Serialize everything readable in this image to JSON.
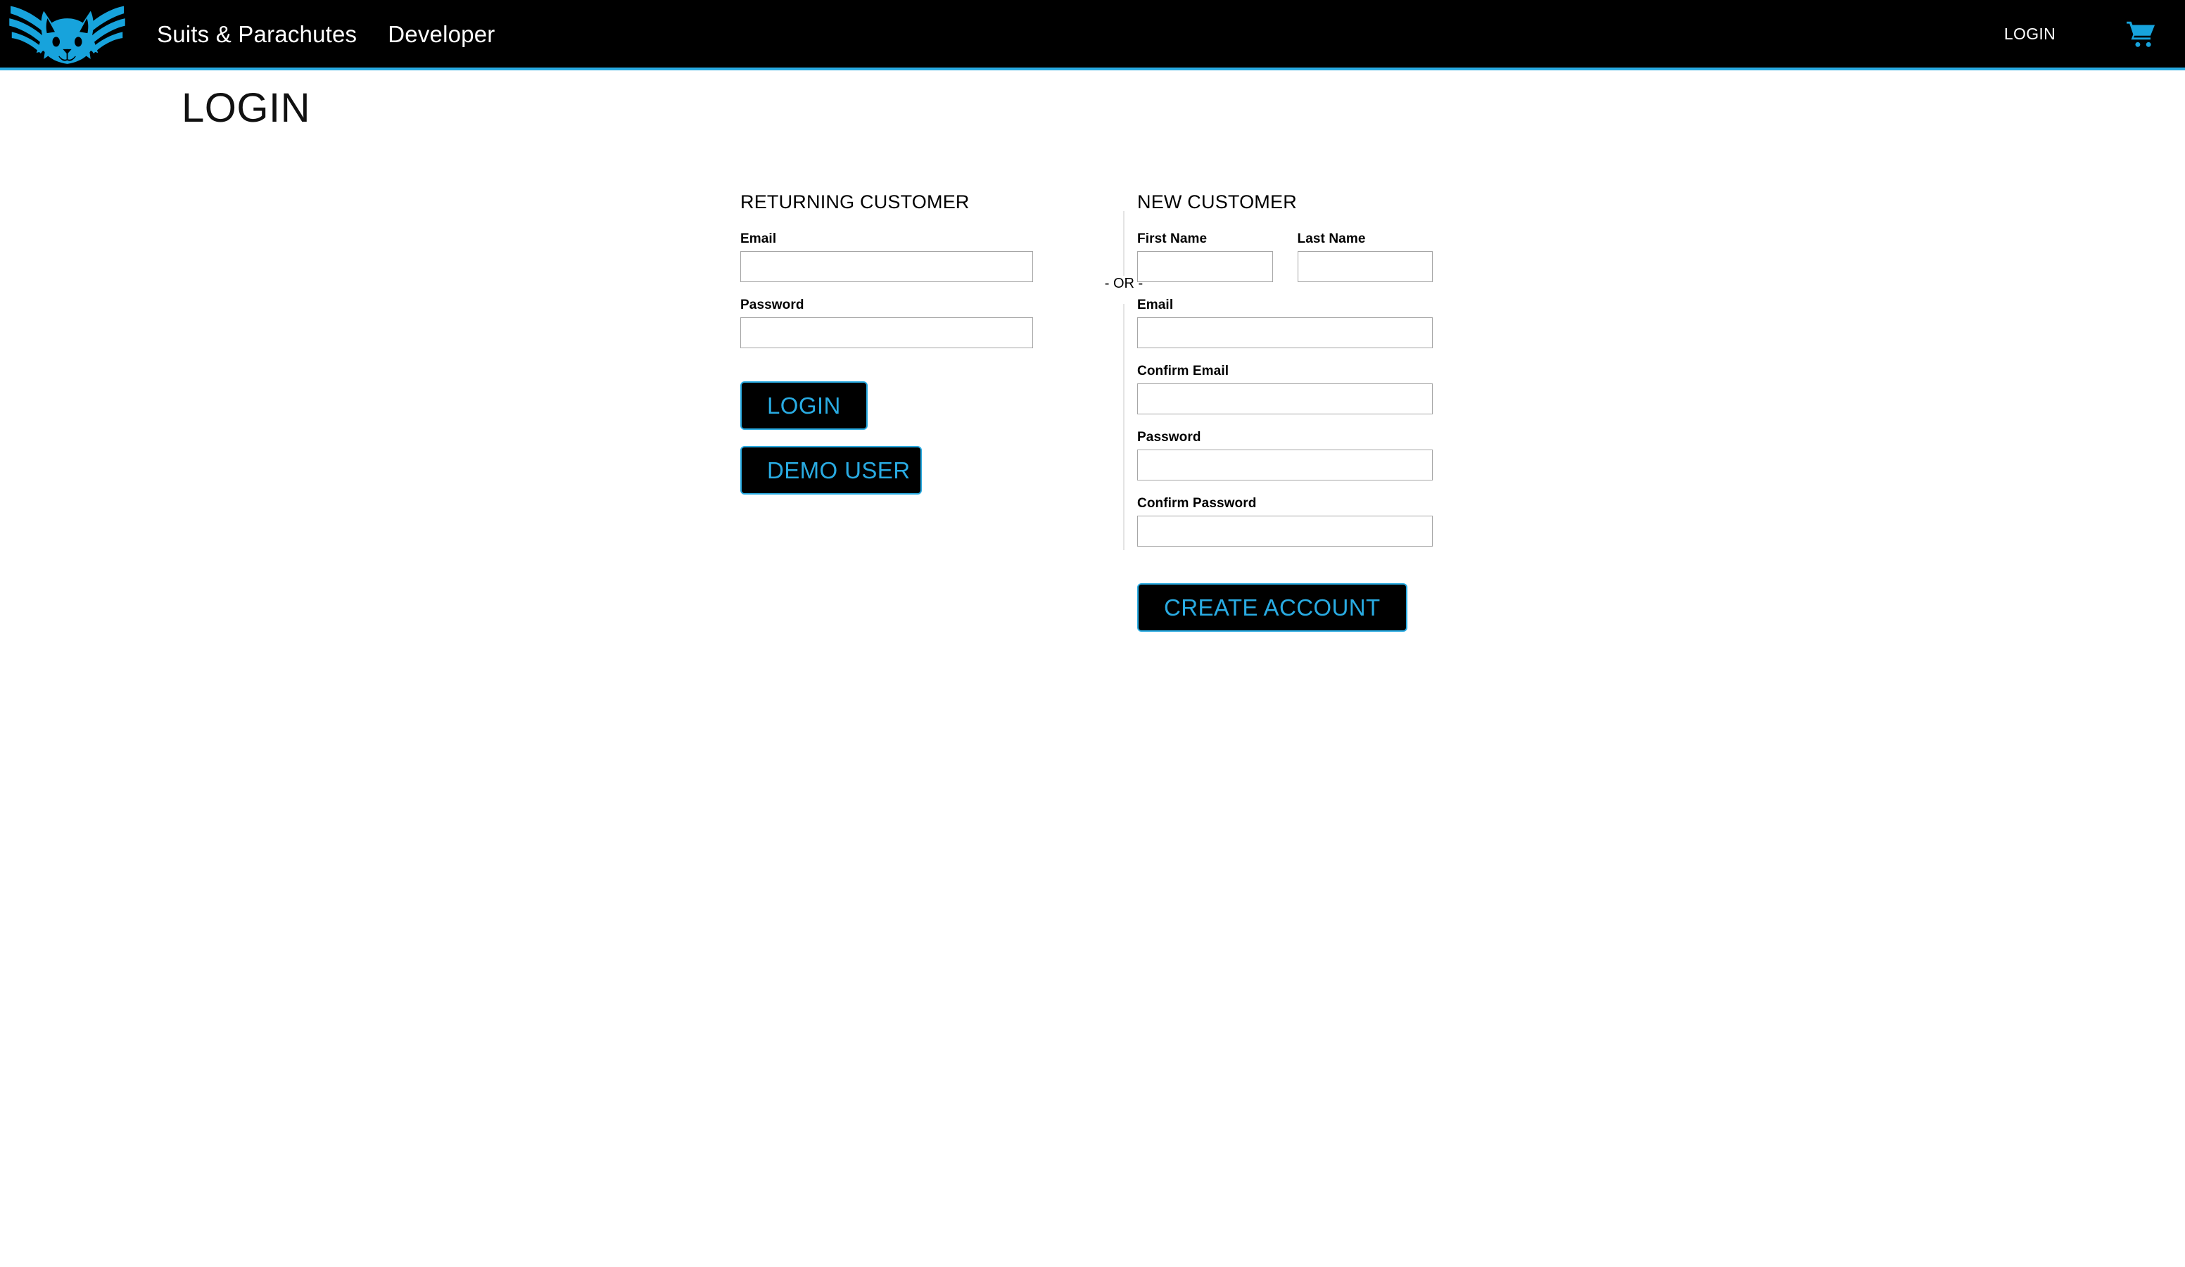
{
  "navbar": {
    "logo_icon": "winged-fox-logo-icon",
    "links": [
      {
        "label": "Suits & Parachutes"
      },
      {
        "label": "Developer"
      }
    ],
    "login_label": "LOGIN",
    "cart_icon": "shopping-cart-icon",
    "background_color": "#000000",
    "accent_color": "#29abe2",
    "text_color": "#ffffff"
  },
  "page": {
    "title": "LOGIN",
    "background_color": "#ffffff"
  },
  "returning_customer": {
    "heading": "RETURNING CUSTOMER",
    "email": {
      "label": "Email",
      "value": "",
      "placeholder": ""
    },
    "password": {
      "label": "Password",
      "value": "",
      "placeholder": ""
    },
    "login_button": "LOGIN",
    "demo_button": "DEMO USER"
  },
  "divider": {
    "text": "- OR -",
    "line_color": "#c9c9c9"
  },
  "new_customer": {
    "heading": "NEW CUSTOMER",
    "first_name": {
      "label": "First Name",
      "value": "",
      "placeholder": ""
    },
    "last_name": {
      "label": "Last Name",
      "value": "",
      "placeholder": ""
    },
    "email": {
      "label": "Email",
      "value": "",
      "placeholder": ""
    },
    "confirm_email": {
      "label": "Confirm Email",
      "value": "",
      "placeholder": ""
    },
    "password": {
      "label": "Password",
      "value": "",
      "placeholder": ""
    },
    "confirm_password": {
      "label": "Confirm Password",
      "value": "",
      "placeholder": ""
    },
    "create_button": "CREATE ACCOUNT"
  },
  "colors": {
    "accent": "#29abe2",
    "button_bg": "#000000",
    "input_border": "#a6a6a6",
    "page_bg": "#ffffff",
    "text": "#000000"
  }
}
